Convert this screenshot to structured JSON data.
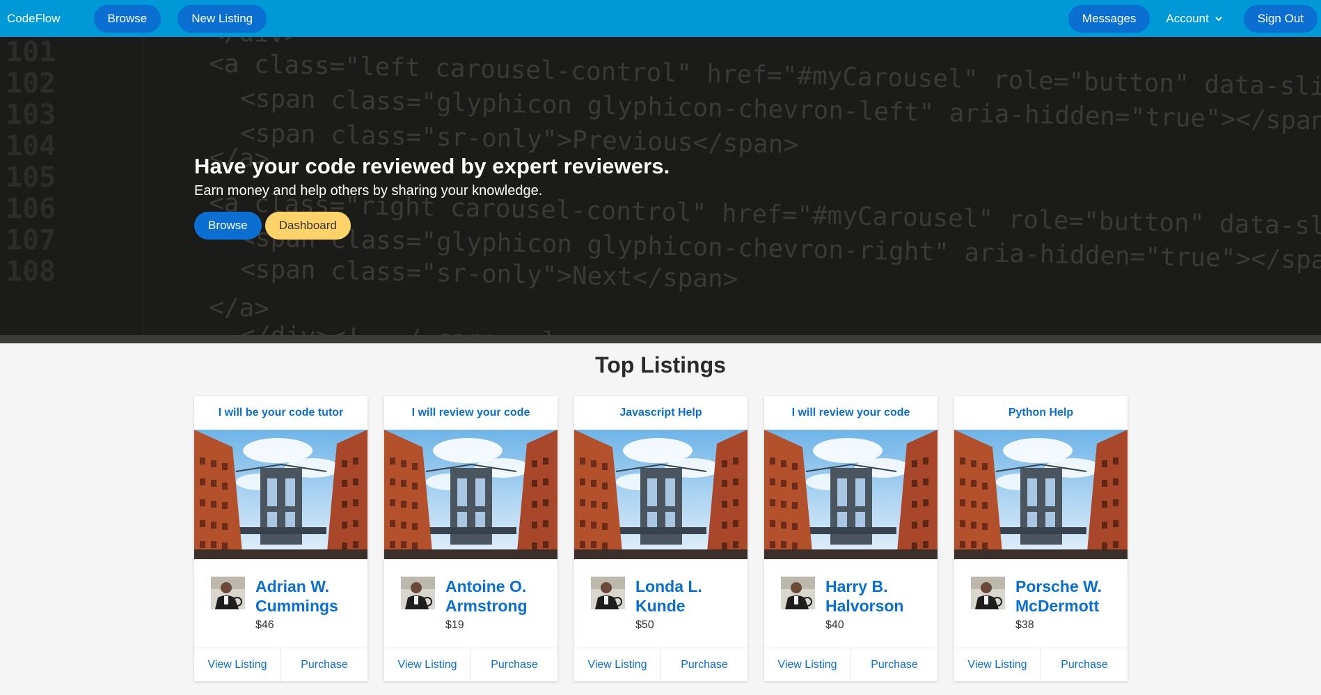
{
  "nav": {
    "brand": "CodeFlow",
    "browse": "Browse",
    "new_listing": "New Listing",
    "messages": "Messages",
    "account": "Account",
    "sign_out": "Sign Out"
  },
  "hero": {
    "title": "Have your code reviewed by expert reviewers.",
    "subtitle": "Earn money and help others by sharing your knowledge.",
    "browse_button": "Browse",
    "dashboard_button": "Dashboard",
    "code_lines": {
      "numbers": [
        "101",
        "102",
        "103",
        "104",
        "105",
        "106",
        "107",
        "108"
      ],
      "text": [
        "</div>",
        "<a class=\"left carousel-control\" href=\"#myCarousel\" role=\"button\" data-slide=\"prev\">",
        "<span class=\"glyphicon glyphicon-chevron-left\" aria-hidden=\"true\"></span>",
        "<span class=\"sr-only\">Previous</span>",
        "</a>",
        "<a class=\"right carousel-control\" href=\"#myCarousel\" role=\"button\" data-slide=\"next\">",
        "<span class=\"glyphicon glyphicon-chevron-right\" aria-hidden=\"true\"></span>",
        "<span class=\"sr-only\">Next</span>",
        "</a>",
        "</div><!-- /.carousel -->"
      ]
    }
  },
  "listings": {
    "title": "Top Listings",
    "view_label": "View Listing",
    "purchase_label": "Purchase",
    "items": [
      {
        "title": "I will be your code tutor",
        "seller": "Adrian W. Cummings",
        "price": "$46"
      },
      {
        "title": "I will review your code",
        "seller": "Antoine O. Armstrong",
        "price": "$19"
      },
      {
        "title": "Javascript Help",
        "seller": "Londa L. Kunde",
        "price": "$50"
      },
      {
        "title": "I will review your code",
        "seller": "Harry B. Halvorson",
        "price": "$40"
      },
      {
        "title": "Python Help",
        "seller": "Porsche W. McDermott",
        "price": "$38"
      }
    ]
  },
  "colors": {
    "navbar": "#0098d6",
    "primary": "#0a6fd0",
    "warning": "#ffd36a"
  },
  "icons": {
    "account_dropdown": "chevron-down-icon"
  }
}
